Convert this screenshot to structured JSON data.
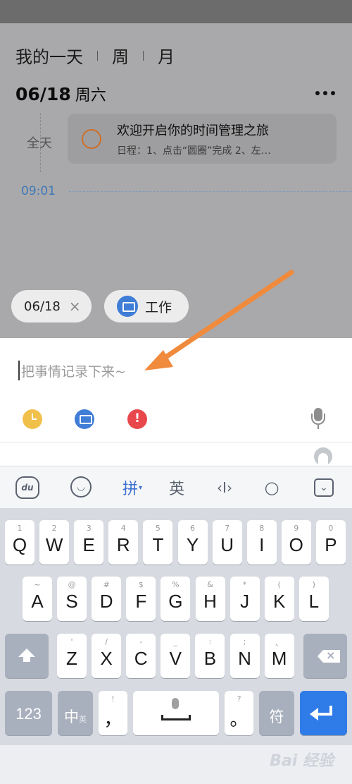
{
  "calendar": {
    "tabs": [
      "我的一天",
      "周",
      "月"
    ],
    "date": "06/18",
    "weekday": "周六",
    "allday_label": "全天",
    "event": {
      "title": "欢迎开启你的时间管理之旅",
      "description": "日程：1、点击“圆圈”完成 2、左…"
    },
    "current_time": "09:01"
  },
  "chips": {
    "date": "06/18",
    "date_clear": "×",
    "tag": "工作"
  },
  "input": {
    "placeholder": "把事情记录下来~",
    "priority_symbol": "!"
  },
  "keyboard": {
    "toolbar": {
      "du": "du",
      "emoji": "◡",
      "pinyin": "拼",
      "pinyin_arrow": "▾",
      "english": "英",
      "cursor": "‹I›",
      "search": "○",
      "hide": "⌄"
    },
    "row1": [
      {
        "main": "Q",
        "sub": "1"
      },
      {
        "main": "W",
        "sub": "2"
      },
      {
        "main": "E",
        "sub": "3"
      },
      {
        "main": "R",
        "sub": "4"
      },
      {
        "main": "T",
        "sub": "5"
      },
      {
        "main": "Y",
        "sub": "6"
      },
      {
        "main": "U",
        "sub": "7"
      },
      {
        "main": "I",
        "sub": "8"
      },
      {
        "main": "O",
        "sub": "9"
      },
      {
        "main": "P",
        "sub": "0"
      }
    ],
    "row2": [
      {
        "main": "A",
        "sub": "~"
      },
      {
        "main": "S",
        "sub": "@"
      },
      {
        "main": "D",
        "sub": "#"
      },
      {
        "main": "F",
        "sub": "$"
      },
      {
        "main": "G",
        "sub": "%"
      },
      {
        "main": "H",
        "sub": "&"
      },
      {
        "main": "J",
        "sub": "*"
      },
      {
        "main": "K",
        "sub": "("
      },
      {
        "main": "L",
        "sub": ")"
      }
    ],
    "row3": [
      {
        "main": "Z",
        "sub": "'"
      },
      {
        "main": "X",
        "sub": "/"
      },
      {
        "main": "C",
        "sub": "-"
      },
      {
        "main": "V",
        "sub": "_"
      },
      {
        "main": "B",
        "sub": ":"
      },
      {
        "main": "N",
        "sub": ";"
      },
      {
        "main": "M",
        "sub": "、"
      }
    ],
    "numbers_key": "123",
    "zh_key": "中",
    "zh_key_sub": "英",
    "comma_key": {
      "main": "，",
      "sub": "!"
    },
    "period_key": {
      "main": "。",
      "sub": "?"
    },
    "symbols_key": "符"
  },
  "watermark": "Bai 经验",
  "colors": {
    "accent_blue": "#3f7dd6",
    "clock_yellow": "#f1c04b",
    "priority_red": "#e8474c",
    "arrow_orange": "#f08a3c",
    "enter_blue": "#2f7ce8"
  }
}
